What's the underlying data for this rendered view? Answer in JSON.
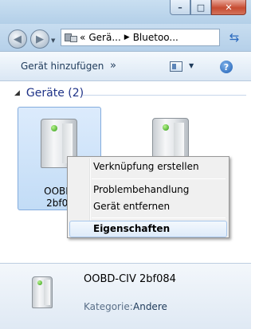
{
  "window": {
    "caption_buttons": {
      "minimize": "–",
      "maximize": "□",
      "close": "✕"
    }
  },
  "navigation": {
    "back_icon": "back-arrow-icon",
    "forward_icon": "forward-arrow-icon",
    "address": {
      "overflow": "«",
      "segments": [
        "Gerä...",
        "Bluetoo..."
      ],
      "separator": "▶"
    },
    "refresh_icon": "refresh-icon"
  },
  "commandbar": {
    "add_device": "Gerät hinzufügen",
    "more": "»",
    "help": "?"
  },
  "group": {
    "chevron": "◢",
    "title": "Geräte (2)"
  },
  "devices": [
    {
      "line1": "OOBD-",
      "line2": "2bf08"
    },
    {
      "line1": "",
      "line2": ""
    }
  ],
  "context_menu": {
    "items": [
      "Verknüpfung erstellen",
      "Problembehandlung",
      "Gerät entfernen",
      "Eigenschaften"
    ]
  },
  "details": {
    "name": "OOBD-CIV 2bf084",
    "category_label": "Kategorie:",
    "category_value": "Andere"
  }
}
